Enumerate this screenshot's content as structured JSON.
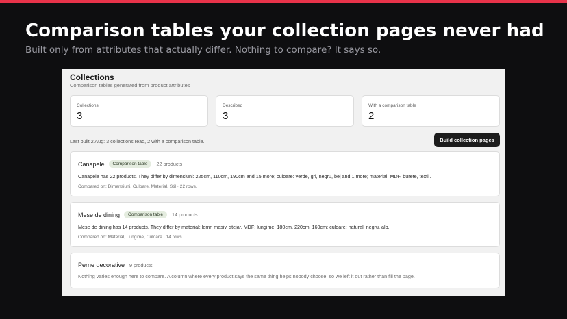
{
  "hero": {
    "title": "Comparison tables your collection pages never had",
    "subtitle": "Built only from attributes that actually differ. Nothing to compare? It says so."
  },
  "colors": {
    "accent_stripe": "#e8334a",
    "background": "#0e0e10",
    "badge_bg": "#e4ecdf",
    "button_bg": "#1c1c1c"
  },
  "app": {
    "title": "Collections",
    "subtitle": "Comparison tables generated from product attributes",
    "stats": [
      {
        "label": "Collections",
        "value": "3"
      },
      {
        "label": "Described",
        "value": "3"
      },
      {
        "label": "With a comparison table",
        "value": "2"
      }
    ],
    "status": "Last built 2 Aug: 3 collections read, 2 with a comparison table.",
    "build_button": "Build collection pages",
    "collections": [
      {
        "name": "Canapele",
        "badge": "Comparison table",
        "count": "22 products",
        "description": "Canapele has 22 products. They differ by dimensiuni: 225cm, 110cm, 190cm and 15 more; culoare: verde, gri, negru, bej and 1 more; material: MDF, burete, textil.",
        "compared_on": "Compared on: Dimensiuni, Culoare, Material, Stil · 22 rows."
      },
      {
        "name": "Mese de dining",
        "badge": "Comparison table",
        "count": "14 products",
        "description": "Mese de dining has 14 products. They differ by material: lemn masiv, stejar, MDF; lungime: 180cm, 220cm, 160cm; culoare: natural, negru, alb.",
        "compared_on": "Compared on: Material, Lungime, Culoare · 14 rows."
      },
      {
        "name": "Perne decorative",
        "count": "9 products",
        "description": "Nothing varies enough here to compare. A column where every product says the same thing helps nobody choose, so we left it out rather than fill the page."
      }
    ]
  }
}
